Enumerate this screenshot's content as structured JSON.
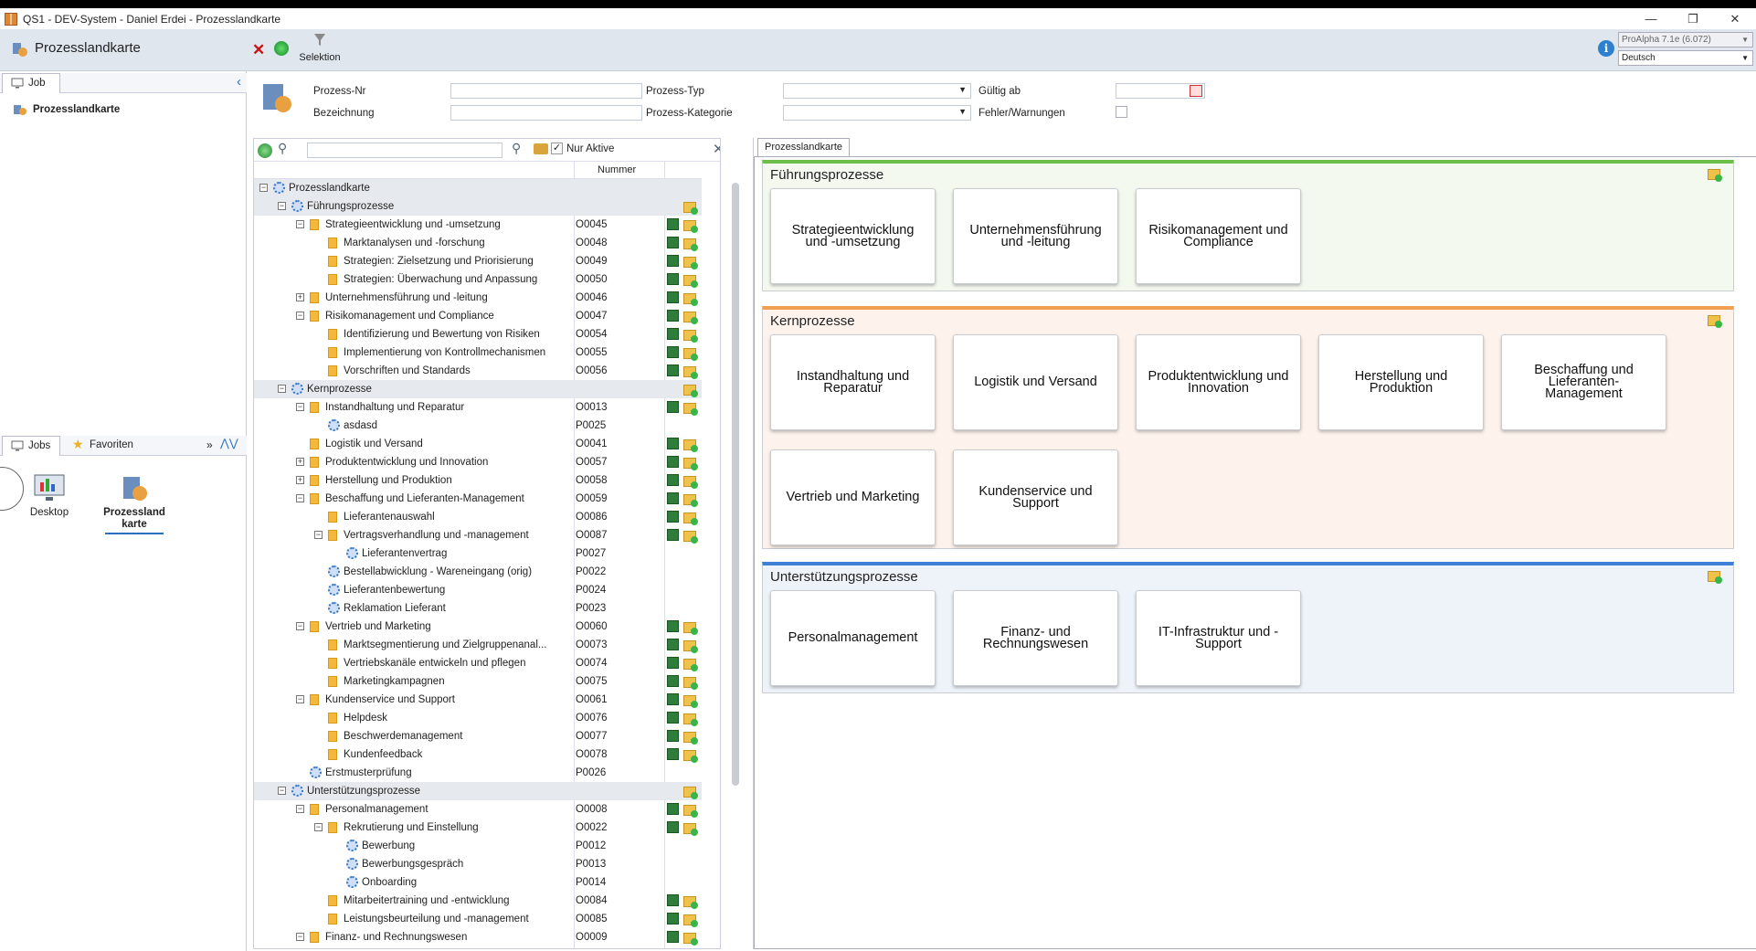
{
  "window": {
    "title": "QS1 - DEV-System - Daniel Erdei - Prozesslandkarte",
    "buttons": [
      "—",
      "❐",
      "✕"
    ]
  },
  "appbar": {
    "title": "Prozesslandkarte",
    "selektion_label": "Selektion",
    "version": "ProAlpha 7.1e (6.072)",
    "language": "Deutsch"
  },
  "left": {
    "tab_job": "Job",
    "job_item": "Prozesslandkarte",
    "tab_jobs": "Jobs",
    "tab_favoriten": "Favoriten",
    "desktop_label": "Desktop",
    "prozesslandkarte_label": "Prozessland karte"
  },
  "form": {
    "prozess_nr_label": "Prozess-Nr",
    "bezeichnung_label": "Bezeichnung",
    "prozess_typ_label": "Prozess-Typ",
    "prozess_kategorie_label": "Prozess-Kategorie",
    "gueltig_ab_label": "Gültig ab",
    "fehler_label": "Fehler/Warnungen"
  },
  "tree": {
    "nur_aktive_label": "Nur Aktive",
    "col_nummer": "Nummer",
    "rows": [
      {
        "label": "Prozesslandkarte",
        "num": "",
        "level": 0,
        "type": "root",
        "exp": "−",
        "grp": true
      },
      {
        "label": "Führungsprozesse",
        "num": "",
        "level": 1,
        "type": "proc",
        "exp": "−",
        "grp": true
      },
      {
        "label": "Strategieentwicklung und -umsetzung",
        "num": "O0045",
        "level": 2,
        "type": "fold",
        "exp": "−"
      },
      {
        "label": "Marktanalysen und -forschung",
        "num": "O0048",
        "level": 3,
        "type": "fold",
        "exp": ""
      },
      {
        "label": "Strategien: Zielsetzung und Priorisierung",
        "num": "O0049",
        "level": 3,
        "type": "fold",
        "exp": ""
      },
      {
        "label": "Strategien: Überwachung und Anpassung",
        "num": "O0050",
        "level": 3,
        "type": "fold",
        "exp": ""
      },
      {
        "label": "Unternehmensführung und -leitung",
        "num": "O0046",
        "level": 2,
        "type": "fold",
        "exp": "+"
      },
      {
        "label": "Risikomanagement und Compliance",
        "num": "O0047",
        "level": 2,
        "type": "fold",
        "exp": "−"
      },
      {
        "label": "Identifizierung und Bewertung von Risiken",
        "num": "O0054",
        "level": 3,
        "type": "fold",
        "exp": ""
      },
      {
        "label": "Implementierung von Kontrollmechanismen",
        "num": "O0055",
        "level": 3,
        "type": "fold",
        "exp": ""
      },
      {
        "label": "Vorschriften und Standards",
        "num": "O0056",
        "level": 3,
        "type": "fold",
        "exp": ""
      },
      {
        "label": "Kernprozesse",
        "num": "",
        "level": 1,
        "type": "proc",
        "exp": "−",
        "grp": true
      },
      {
        "label": "Instandhaltung und Reparatur",
        "num": "O0013",
        "level": 2,
        "type": "fold",
        "exp": "−"
      },
      {
        "label": "asdasd",
        "num": "P0025",
        "level": 3,
        "type": "proc",
        "exp": "",
        "noact": true
      },
      {
        "label": "Logistik und Versand",
        "num": "O0041",
        "level": 2,
        "type": "fold",
        "exp": ""
      },
      {
        "label": "Produktentwicklung und Innovation",
        "num": "O0057",
        "level": 2,
        "type": "fold",
        "exp": "+"
      },
      {
        "label": "Herstellung und Produktion",
        "num": "O0058",
        "level": 2,
        "type": "fold",
        "exp": "+"
      },
      {
        "label": "Beschaffung und Lieferanten-Management",
        "num": "O0059",
        "level": 2,
        "type": "fold",
        "exp": "−"
      },
      {
        "label": "Lieferantenauswahl",
        "num": "O0086",
        "level": 3,
        "type": "fold",
        "exp": ""
      },
      {
        "label": "Vertragsverhandlung und -management",
        "num": "O0087",
        "level": 3,
        "type": "fold",
        "exp": "−"
      },
      {
        "label": "Lieferantenvertrag",
        "num": "P0027",
        "level": 4,
        "type": "proc",
        "exp": "",
        "noact": true
      },
      {
        "label": "Bestellabwicklung - Wareneingang (orig)",
        "num": "P0022",
        "level": 3,
        "type": "proc",
        "exp": "",
        "noact": true
      },
      {
        "label": "Lieferantenbewertung",
        "num": "P0024",
        "level": 3,
        "type": "proc",
        "exp": "",
        "noact": true
      },
      {
        "label": "Reklamation Lieferant",
        "num": "P0023",
        "level": 3,
        "type": "proc",
        "exp": "",
        "noact": true
      },
      {
        "label": "Vertrieb und Marketing",
        "num": "O0060",
        "level": 2,
        "type": "fold",
        "exp": "−"
      },
      {
        "label": "Marktsegmentierung und Zielgruppenanal...",
        "num": "O0073",
        "level": 3,
        "type": "fold",
        "exp": ""
      },
      {
        "label": "Vertriebskanäle entwickeln und pflegen",
        "num": "O0074",
        "level": 3,
        "type": "fold",
        "exp": ""
      },
      {
        "label": "Marketingkampagnen",
        "num": "O0075",
        "level": 3,
        "type": "fold",
        "exp": ""
      },
      {
        "label": "Kundenservice und Support",
        "num": "O0061",
        "level": 2,
        "type": "fold",
        "exp": "−"
      },
      {
        "label": "Helpdesk",
        "num": "O0076",
        "level": 3,
        "type": "fold",
        "exp": ""
      },
      {
        "label": "Beschwerdemanagement",
        "num": "O0077",
        "level": 3,
        "type": "fold",
        "exp": ""
      },
      {
        "label": "Kundenfeedback",
        "num": "O0078",
        "level": 3,
        "type": "fold",
        "exp": ""
      },
      {
        "label": "Erstmusterprüfung",
        "num": "P0026",
        "level": 2,
        "type": "proc",
        "exp": "",
        "noact": true
      },
      {
        "label": "Unterstützungsprozesse",
        "num": "",
        "level": 1,
        "type": "proc",
        "exp": "−",
        "grp": true
      },
      {
        "label": "Personalmanagement",
        "num": "O0008",
        "level": 2,
        "type": "fold",
        "exp": "−"
      },
      {
        "label": "Rekrutierung und Einstellung",
        "num": "O0022",
        "level": 3,
        "type": "fold",
        "exp": "−"
      },
      {
        "label": "Bewerbung",
        "num": "P0012",
        "level": 4,
        "type": "proc",
        "exp": "",
        "noact": true
      },
      {
        "label": "Bewerbungsgespräch",
        "num": "P0013",
        "level": 4,
        "type": "proc",
        "exp": "",
        "noact": true
      },
      {
        "label": "Onboarding",
        "num": "P0014",
        "level": 4,
        "type": "proc",
        "exp": "",
        "noact": true
      },
      {
        "label": "Mitarbeitertraining und -entwicklung",
        "num": "O0084",
        "level": 3,
        "type": "fold",
        "exp": ""
      },
      {
        "label": "Leistungsbeurteilung und -management",
        "num": "O0085",
        "level": 3,
        "type": "fold",
        "exp": ""
      },
      {
        "label": "Finanz- und Rechnungswesen",
        "num": "O0009",
        "level": 2,
        "type": "fold",
        "exp": "−"
      }
    ]
  },
  "map": {
    "tab": "Prozesslandkarte",
    "sections": [
      {
        "title": "Führungsprozesse",
        "color": "#6cc04a",
        "bg": "#f3f9ef",
        "cards": [
          "Strategieentwicklung und -umsetzung",
          "Unternehmensführung und -leitung",
          "Risikomanagement und Compliance"
        ]
      },
      {
        "title": "Kernprozesse",
        "color": "#f0a050",
        "bg": "#fdf3ec",
        "cards": [
          "Instandhaltung und Reparatur",
          "Logistik und Versand",
          "Produktentwicklung und Innovation",
          "Herstellung und Produktion",
          "Beschaffung und Lieferanten-Management",
          "Vertrieb und Marketing",
          "Kundenservice und Support"
        ]
      },
      {
        "title": "Unterstützungsprozesse",
        "color": "#3f7fd6",
        "bg": "#eef3fa",
        "cards": [
          "Personalmanagement",
          "Finanz- und Rechnungswesen",
          "IT-Infrastruktur und -Support"
        ]
      }
    ]
  }
}
